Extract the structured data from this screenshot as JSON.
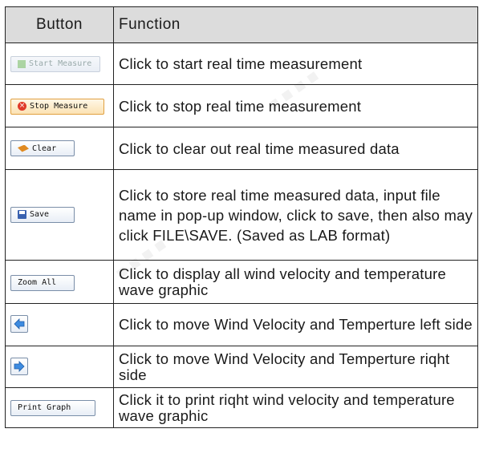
{
  "table": {
    "header": {
      "button": "Button",
      "function": "Function"
    },
    "rows": [
      {
        "button_label": "Start Measure",
        "icon": "play-icon",
        "description": "Click to start real time measurement"
      },
      {
        "button_label": "Stop Measure",
        "icon": "stop-icon",
        "description": "Click to stop real time measurement"
      },
      {
        "button_label": "Clear",
        "icon": "eraser-icon",
        "description": "Click to clear out real time measured data"
      },
      {
        "button_label": "Save",
        "icon": "floppy-disk-icon",
        "description": "Click to store real time measured data, input file name in pop-up window, click to save, then also may click FILE\\SAVE. (Saved as LAB format)"
      },
      {
        "button_label": "Zoom All",
        "icon": "",
        "description": "Click to display all wind velocity and temperature wave graphic"
      },
      {
        "button_label": "",
        "icon": "left-arrow-icon",
        "description": "Click to move Wind Velocity and Temperture left side"
      },
      {
        "button_label": "",
        "icon": "right-arrow-icon",
        "description": "Click to move Wind Velocity and Temperture riqht side"
      },
      {
        "button_label": "Print Graph",
        "icon": "",
        "description": "Click it to print riqht wind velocity and temperature wave graphic"
      }
    ]
  },
  "colors": {
    "header_bg": "#dcdcdc",
    "border": "#222222",
    "arrow_fill": "#3d8be0"
  }
}
